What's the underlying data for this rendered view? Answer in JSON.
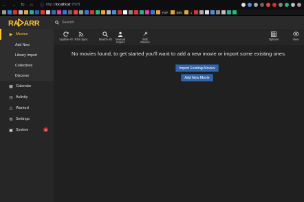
{
  "browser": {
    "url_prefix": "http://",
    "url_host": "localhost",
    "url_port": ":7878",
    "bookmarks_text": [
      "P2P",
      "Bills",
      "1"
    ]
  },
  "app": {
    "search_placeholder": "Search"
  },
  "sidebar": {
    "items": [
      {
        "label": "Movies",
        "icon": "play-icon",
        "active": true
      },
      {
        "label": "Calendar",
        "icon": "calendar-icon"
      },
      {
        "label": "Activity",
        "icon": "clock-icon"
      },
      {
        "label": "Wanted",
        "icon": "warning-icon"
      },
      {
        "label": "Settings",
        "icon": "cogs-icon"
      },
      {
        "label": "System",
        "icon": "laptop-icon",
        "badge": "3"
      }
    ],
    "sub_items": [
      "Add New",
      "Library Import",
      "Collections",
      "Discover"
    ]
  },
  "toolbar": {
    "update_all": "Update All",
    "rss_sync": "RSS Sync",
    "search_all": "Search All",
    "manual_import_1": "Manual",
    "manual_import_2": "Import",
    "edit_movies_1": "Edit",
    "edit_movies_2": "Movies",
    "options": "Options",
    "view": "View"
  },
  "main": {
    "empty_message": "No movies found, to get started you'll want to add a new movie or import some existing ones.",
    "import_button": "Import Existing Movies",
    "add_button": "Add New Movie"
  },
  "colors": {
    "accent": "#ffc230",
    "button_primary": "#3264a8",
    "badge": "#c0262d"
  }
}
